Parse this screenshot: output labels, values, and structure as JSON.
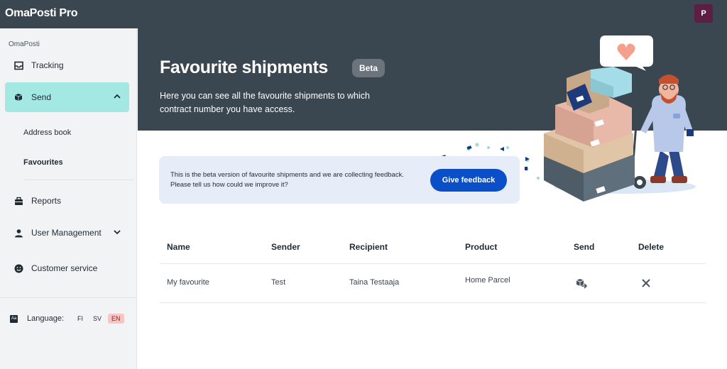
{
  "app": {
    "title": "OmaPosti Pro",
    "user_initial": "P"
  },
  "sidebar": {
    "section_label": "OmaPosti",
    "items": [
      {
        "label": "Tracking",
        "icon": "inbox-icon"
      },
      {
        "label": "Send",
        "icon": "parcel-icon",
        "expanded": true,
        "children": [
          {
            "label": "Address book"
          },
          {
            "label": "Favourites",
            "current": true
          }
        ]
      },
      {
        "label": "Reports",
        "icon": "briefcase-icon"
      },
      {
        "label": "User Management",
        "icon": "user-icon",
        "expanded": false
      },
      {
        "label": "Customer service",
        "icon": "smile-icon"
      }
    ],
    "language": {
      "label": "Language:",
      "options": [
        "FI",
        "SV",
        "EN"
      ],
      "selected": "EN"
    }
  },
  "hero": {
    "title": "Favourite shipments",
    "badge": "Beta",
    "description": "Here you can see all the favourite shipments to which contract number you have access."
  },
  "feedback": {
    "text": "This is the beta version of favourite shipments and we are collecting feedback. Please tell us how could we improve it?",
    "button_label": "Give feedback"
  },
  "table": {
    "columns": [
      "Name",
      "Sender",
      "Recipient",
      "Product",
      "Send",
      "Delete"
    ],
    "rows": [
      {
        "name": "My favourite",
        "sender": "Test",
        "recipient": "Taina Testaaja",
        "product": "Home Parcel"
      }
    ]
  },
  "colors": {
    "header_bg": "#3a4650",
    "active_nav": "#a4e8e3",
    "primary_button": "#0b4fc8",
    "selected_language": "#f7c6c4",
    "avatar": "#5c1f43"
  }
}
